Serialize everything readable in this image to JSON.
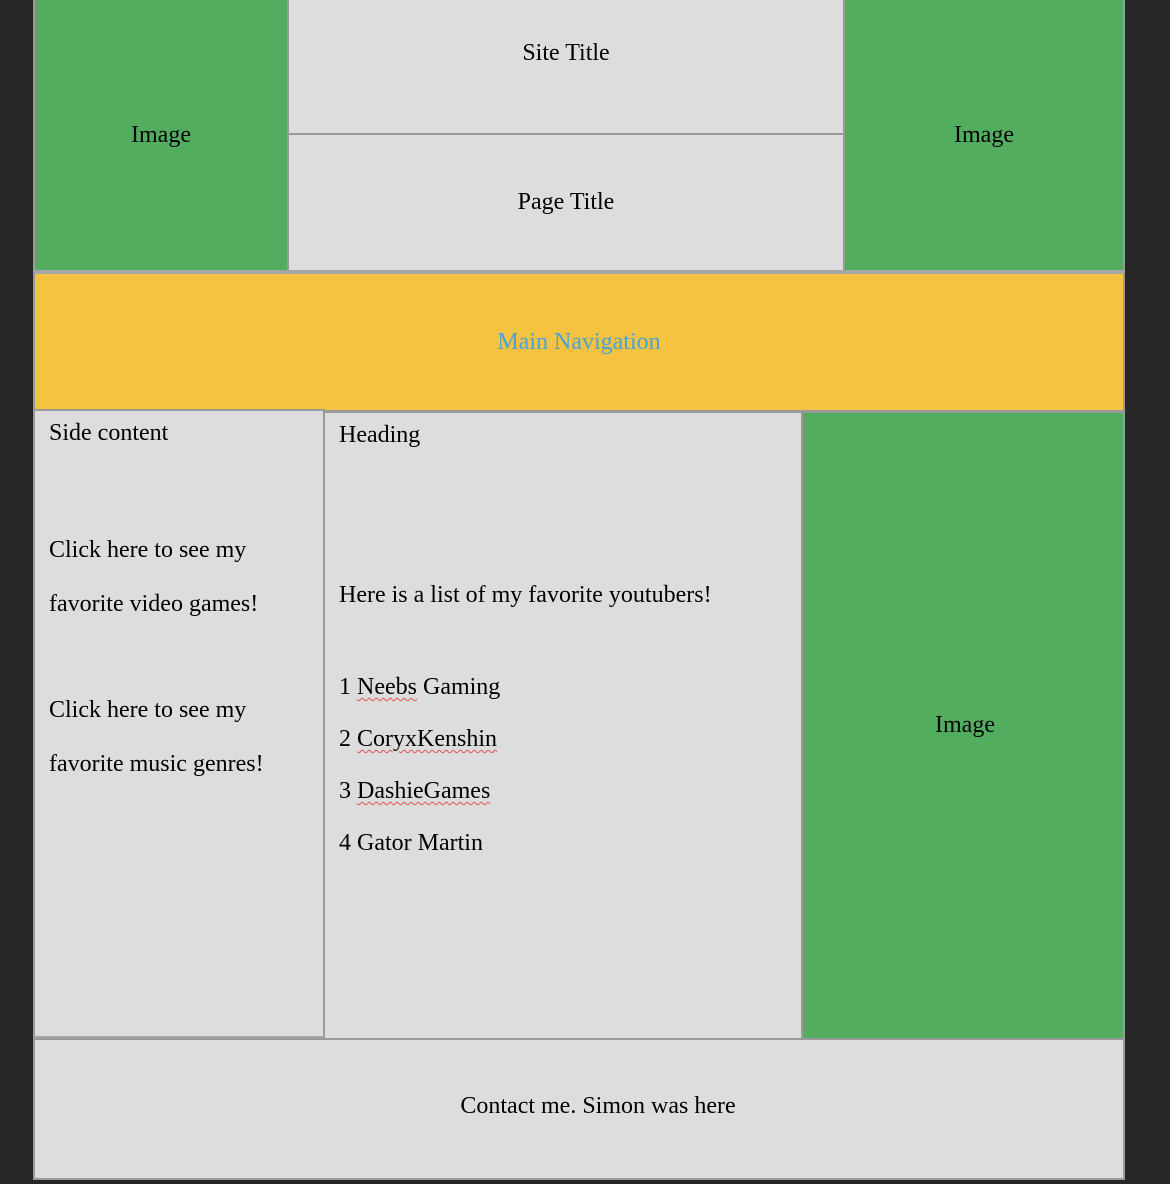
{
  "header": {
    "left_image": "Image",
    "site_title": "Site Title",
    "page_title": "Page Title",
    "right_image": "Image"
  },
  "nav": {
    "label": "Main Navigation"
  },
  "side": {
    "title": "Side content",
    "links": [
      "Click here to see my favorite video games!",
      "Click here to see my favorite music genres!"
    ]
  },
  "main": {
    "heading": "Heading",
    "intro": "Here is a list of my favorite youtubers!",
    "list": [
      {
        "num": "1",
        "name": "Neebs",
        "rest": " Gaming"
      },
      {
        "num": "2",
        "name": "CoryxKenshin",
        "rest": ""
      },
      {
        "num": "3",
        "name": "DashieGames",
        "rest": ""
      },
      {
        "num": "4",
        "name": "Gator Martin",
        "rest": ""
      }
    ]
  },
  "aside": {
    "image": "Image"
  },
  "footer": {
    "text": "Contact me. Simon was here"
  },
  "colors": {
    "background": "#262626",
    "panel": "#dddddd",
    "image_green": "#52ae5e",
    "nav_yellow": "#f5c242",
    "nav_text": "#4aa3d8",
    "border": "#9a9a9a"
  }
}
